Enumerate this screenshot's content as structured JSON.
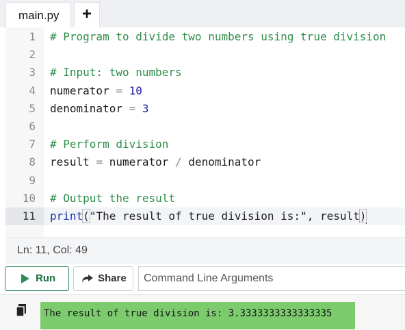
{
  "tabs": {
    "active_tab": "main.py",
    "add_tab": "+"
  },
  "editor": {
    "lines": [
      {
        "num": "1",
        "parts": [
          [
            "cm",
            "# Program to divide two numbers using true division"
          ]
        ]
      },
      {
        "num": "2",
        "parts": []
      },
      {
        "num": "3",
        "parts": [
          [
            "cm",
            "# Input: two numbers"
          ]
        ]
      },
      {
        "num": "4",
        "parts": [
          [
            "id",
            "numerator "
          ],
          [
            "op",
            "="
          ],
          [
            "id",
            " "
          ],
          [
            "num",
            "10"
          ]
        ]
      },
      {
        "num": "5",
        "parts": [
          [
            "id",
            "denominator "
          ],
          [
            "op",
            "="
          ],
          [
            "id",
            " "
          ],
          [
            "num",
            "3"
          ]
        ]
      },
      {
        "num": "6",
        "parts": []
      },
      {
        "num": "7",
        "parts": [
          [
            "cm",
            "# Perform division"
          ]
        ]
      },
      {
        "num": "8",
        "parts": [
          [
            "id",
            "result "
          ],
          [
            "op",
            "="
          ],
          [
            "id",
            " numerator "
          ],
          [
            "op",
            "/"
          ],
          [
            "id",
            " denominator"
          ]
        ]
      },
      {
        "num": "9",
        "parts": []
      },
      {
        "num": "10",
        "parts": [
          [
            "cm",
            "# Output the result"
          ]
        ]
      },
      {
        "num": "11",
        "parts": [
          [
            "kw",
            "print"
          ],
          [
            "paren",
            "("
          ],
          [
            "str",
            "\"The result of true division is:\""
          ],
          [
            "id",
            ", result"
          ],
          [
            "paren",
            ")"
          ]
        ],
        "active": true
      }
    ]
  },
  "status": {
    "position": "Ln: 11,  Col: 49"
  },
  "toolbar": {
    "run_label": "Run",
    "share_label": "Share",
    "args_placeholder": "Command Line Arguments"
  },
  "output": {
    "text": "The result of true division is: 3.3333333333333335"
  },
  "icons": {
    "run": "play-icon",
    "share": "share-icon",
    "copy": "copy-icon"
  },
  "colors": {
    "run_accent": "#2e8b57",
    "output_highlight": "#7ccc6e"
  }
}
